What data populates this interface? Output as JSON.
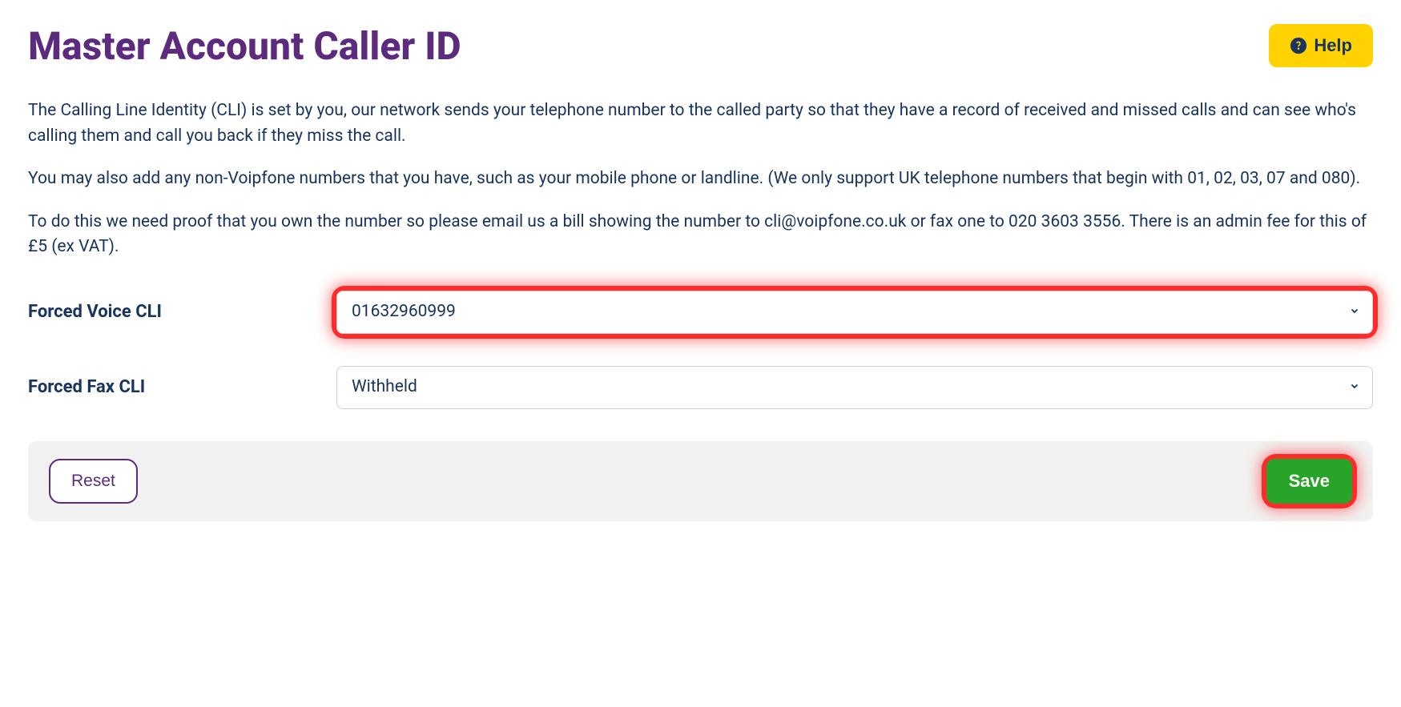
{
  "header": {
    "title": "Master Account Caller ID",
    "help_label": "Help"
  },
  "description": {
    "p1": "The Calling Line Identity (CLI) is set by you, our network sends your telephone number to the called party so that they have a record of received and missed calls and can see who's calling them and call you back if they miss the call.",
    "p2": "You may also add any non-Voipfone numbers that you have, such as your mobile phone or landline. (We only support UK telephone numbers that begin with 01, 02, 03, 07 and 080).",
    "p3": "To do this we need proof that you own the number so please email us a bill showing the number to cli@voipfone.co.uk or fax one to 020 3603 3556. There is an admin fee for this of £5 (ex VAT)."
  },
  "form": {
    "voice_cli": {
      "label": "Forced Voice CLI",
      "value": "01632960999"
    },
    "fax_cli": {
      "label": "Forced Fax CLI",
      "value": "Withheld"
    }
  },
  "actions": {
    "reset_label": "Reset",
    "save_label": "Save"
  }
}
